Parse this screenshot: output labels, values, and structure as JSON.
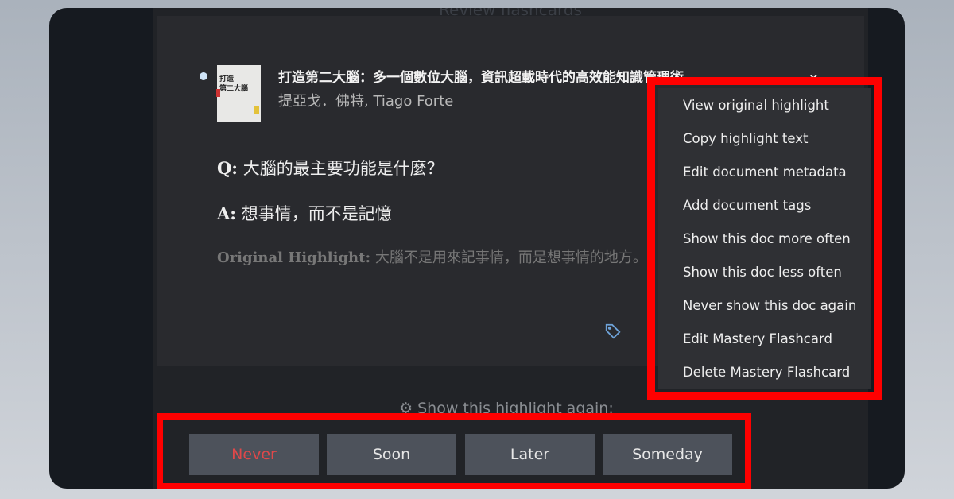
{
  "header": {
    "title": "Review flashcards"
  },
  "book": {
    "title": "打造第二大腦：多一個數位大腦，資訊超載時代的高效能知識管理術",
    "author": "提亞戈．佛特, Tiago Forte",
    "cover_lines": [
      "打造",
      "第二大腦"
    ]
  },
  "card": {
    "q_label": "Q:",
    "question": "大腦的最主要功能是什麼？",
    "a_label": "A:",
    "answer": "想事情，而不是記憶",
    "orig_label": "Original Highlight:",
    "original": "大腦不是用來記事情，而是想事情的地方。"
  },
  "footer": {
    "prompt": "Show this highlight again:",
    "buttons": [
      "Never",
      "Soon",
      "Later",
      "Someday"
    ],
    "never_color": "#e0484a"
  },
  "menu": {
    "items": [
      "View original highlight",
      "Copy highlight text",
      "Edit document metadata",
      "Add document tags",
      "Show this doc more often",
      "Show this doc less often",
      "Never show this doc again",
      "Edit Mastery Flashcard",
      "Delete Mastery Flashcard"
    ]
  },
  "colors": {
    "highlight_box": "#ff0000",
    "icon_accent": "#6ea2d8"
  }
}
